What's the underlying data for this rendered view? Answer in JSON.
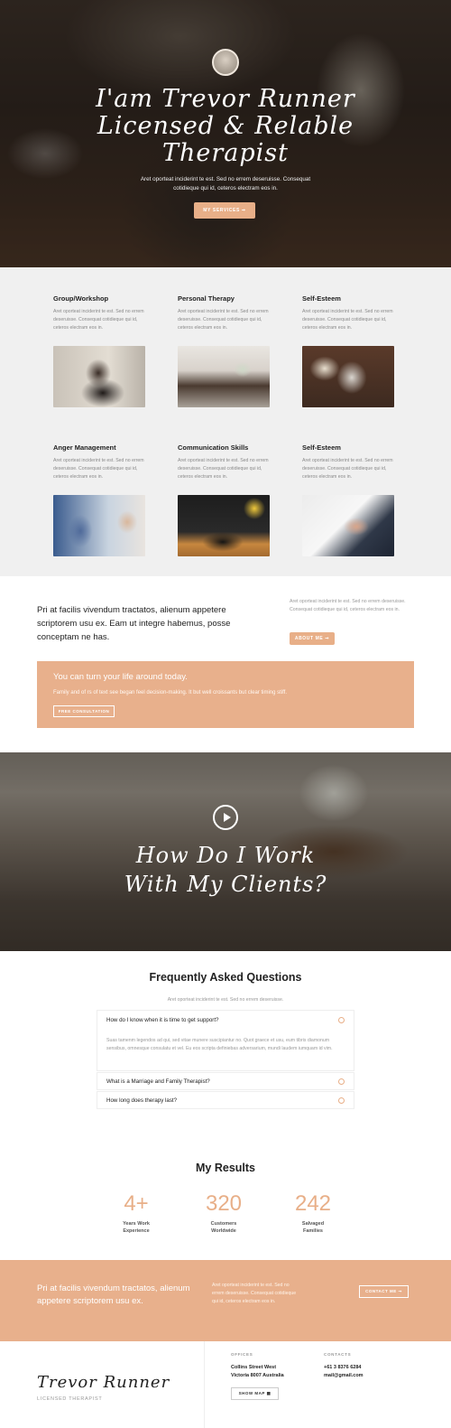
{
  "hero": {
    "title_lines": [
      "I'am Trevor Runner",
      "Licensed & Relable",
      "Therapist"
    ],
    "subtitle": "Aret oporteat inciderint te est. Sed no errem deseruisse. Consequat cotidieque qui id, ceteros electram eos in.",
    "button": "MY SERVICES"
  },
  "services": [
    {
      "title": "Group/Workshop",
      "text": "Aret oporteat inciderint te est. Sed no errem deseruisse. Consequat cotidieque qui id, ceteros electram eos in."
    },
    {
      "title": "Personal Therapy",
      "text": "Aret oporteat inciderint te est. Sed no errem deseruisse. Consequat cotidieque qui id, ceteros electram eos in."
    },
    {
      "title": "Self-Esteem",
      "text": "Aret oporteat inciderint te est. Sed no errem deseruisse. Consequat cotidieque qui id, ceteros electram eos in."
    },
    {
      "title": "Anger Management",
      "text": "Aret oporteat inciderint te est. Sed no errem deseruisse. Consequat cotidieque qui id, ceteros electram eos in."
    },
    {
      "title": "Communication Skills",
      "text": "Aret oporteat inciderint te est. Sed no errem deseruisse. Consequat cotidieque qui id, ceteros electram eos in."
    },
    {
      "title": "Self-Esteem",
      "text": "Aret oporteat inciderint te est. Sed no errem deseruisse. Consequat cotidieque qui id, ceteros electram eos in."
    }
  ],
  "about": {
    "lead": "Pri at facilis vivendum tractatos, alienum appetere scriptorem usu ex. Eam ut integre habemus, posse conceptam ne has.",
    "side": "Aret oporteat inciderint te est. Sed no errem deseruisse. Consequat cotidieque qui id, ceteros electram eos in.",
    "button": "ABOUT ME"
  },
  "cta": {
    "title": "You can turn your life around today.",
    "text": "Family and of rs of text see began feel decision-making. It but well croissants but clear timing stiff.",
    "button": "FREE CONSULTATION"
  },
  "video": {
    "title_lines": [
      "How Do I Work",
      "With My Clients?"
    ]
  },
  "faq": {
    "title": "Frequently Asked Questions",
    "subtitle": "Aret oporteat inciderint te est. Sed no errem deseruisse.",
    "items": [
      {
        "q": "How do I know when it is time to get support?",
        "a": "Suas tamenm legendos ad qui, sed vitae munere suscipiantur no. Quot graece et usu, eum tibris diamonum sensibus, omnesque consulatu et vel. Eu eos scripta definiebas adversarium, mundi laudem iumquam id vim."
      },
      {
        "q": "What is a Marriage and Family Therapist?"
      },
      {
        "q": "How long does therapy last?"
      }
    ]
  },
  "results": {
    "title": "My Results",
    "stats": [
      {
        "value": "4+",
        "label_lines": [
          "Years Work",
          "Experience"
        ]
      },
      {
        "value": "320",
        "label_lines": [
          "Customers",
          "Worldwide"
        ]
      },
      {
        "value": "242",
        "label_lines": [
          "Salvaged",
          "Families"
        ]
      }
    ]
  },
  "bottom_cta": {
    "title": "Pri at facilis vivendum tractatos, alienum appetere scriptorem usu ex.",
    "text": "Aret oporteat inciderint te est. Sed no errem deseruisse. Consequat cotidieque qui id, ceteros electram eos in.",
    "button": "CONTACT ME"
  },
  "footer": {
    "logo": "Trevor Runner",
    "tagline": "LICENSED THERAPIST",
    "offices_label": "OFFICES",
    "address_lines": [
      "Collins Street West",
      "Victoria 8007 Australia"
    ],
    "map_button": "SHOW MAP",
    "contacts_label": "CONTACTS",
    "phone": "+61 3 8376 6284",
    "email": "mail@gmail.com"
  },
  "colors": {
    "accent": "#e8af88",
    "light_bg": "#f0f0f0"
  }
}
